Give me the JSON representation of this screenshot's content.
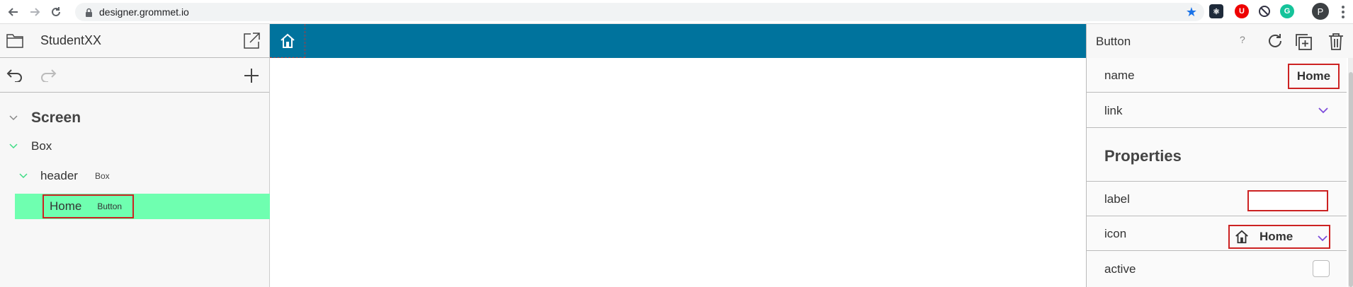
{
  "browser": {
    "url": "designer.grommet.io",
    "profile_initial": "P"
  },
  "left_panel": {
    "app_title": "StudentXX",
    "tree": {
      "screen": "Screen",
      "box": "Box",
      "header_name": "header",
      "header_type": "Box",
      "home_name": "Home",
      "home_type": "Button"
    }
  },
  "right_panel": {
    "component_title": "Button",
    "help_label": "?",
    "rows": {
      "name_label": "name",
      "name_value": "Home",
      "link_label": "link",
      "properties_heading": "Properties",
      "label_label": "label",
      "label_value": "",
      "icon_label": "icon",
      "icon_value": "Home",
      "active_label": "active"
    }
  },
  "colors": {
    "header_bg": "#00739d",
    "selected_row": "#6fffb0",
    "highlight_border": "#cc2222",
    "chevron_accent": "#7d4cdb"
  }
}
